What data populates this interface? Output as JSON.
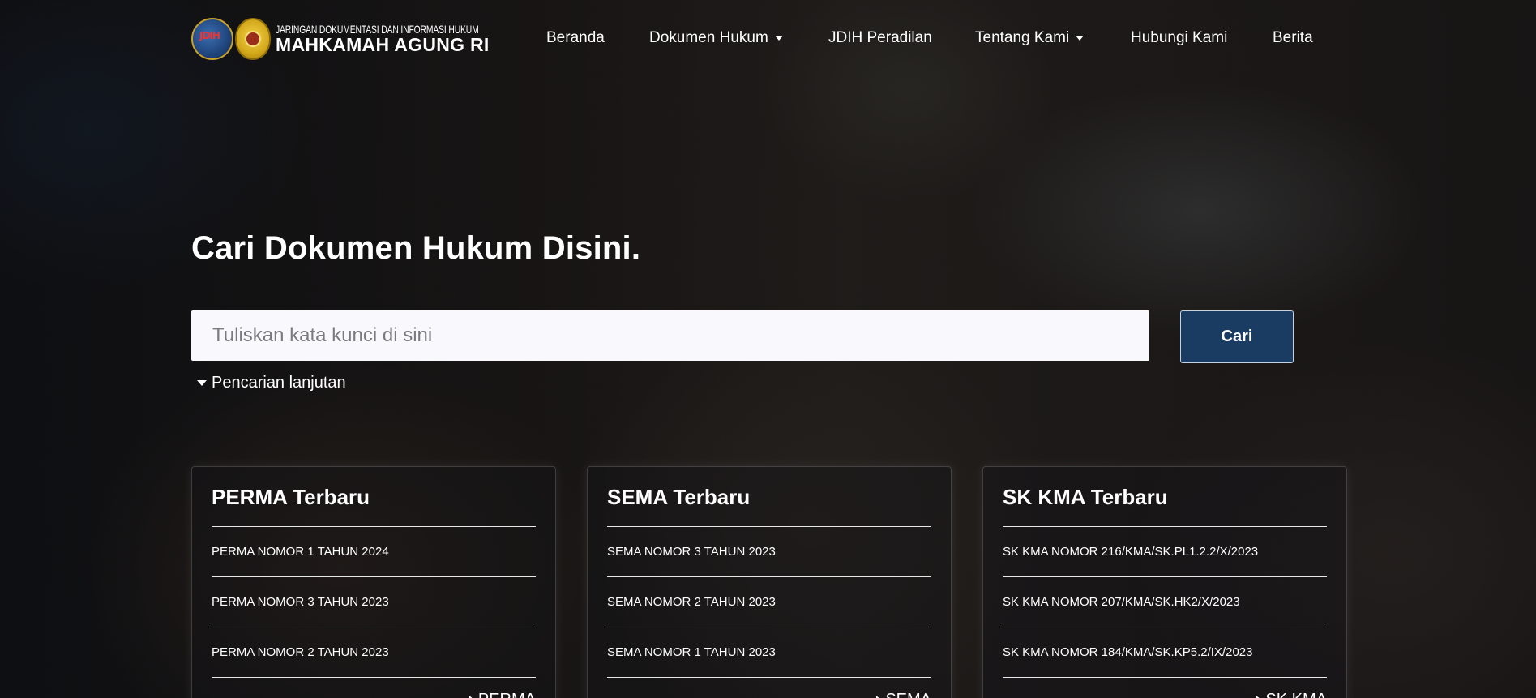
{
  "brand": {
    "logo_text": "JDIH",
    "subtitle": "JARINGAN DOKUMENTASI DAN INFORMASI HUKUM",
    "title": "MAHKAMAH AGUNG RI"
  },
  "nav": {
    "items": [
      {
        "label": "Beranda",
        "dropdown": false
      },
      {
        "label": "Dokumen Hukum",
        "dropdown": true
      },
      {
        "label": "JDIH Peradilan",
        "dropdown": false
      },
      {
        "label": "Tentang Kami",
        "dropdown": true
      },
      {
        "label": "Hubungi Kami",
        "dropdown": false
      },
      {
        "label": "Berita",
        "dropdown": false
      }
    ]
  },
  "hero": {
    "title": "Cari Dokumen Hukum Disini.",
    "search_placeholder": "Tuliskan kata kunci di sini",
    "search_value": "",
    "search_button": "Cari",
    "advanced_label": "Pencarian lanjutan"
  },
  "cards": [
    {
      "title": "PERMA Terbaru",
      "items": [
        "PERMA NOMOR 1 TAHUN 2024",
        "PERMA NOMOR 3 TAHUN 2023",
        "PERMA NOMOR 2 TAHUN 2023"
      ],
      "more": "PERMA"
    },
    {
      "title": "SEMA Terbaru",
      "items": [
        "SEMA NOMOR 3 TAHUN 2023",
        "SEMA NOMOR 2 TAHUN 2023",
        "SEMA NOMOR 1 TAHUN 2023"
      ],
      "more": "SEMA"
    },
    {
      "title": "SK KMA Terbaru",
      "items": [
        "SK KMA NOMOR 216/KMA/SK.PL1.2.2/X/2023",
        "SK KMA NOMOR 207/KMA/SK.HK2/X/2023",
        "SK KMA NOMOR 184/KMA/SK.KP5.2/IX/2023"
      ],
      "more": "SK KMA"
    }
  ],
  "colors": {
    "search_button_bg": "#1a3c63",
    "search_input_bg": "#f8f8fd"
  }
}
